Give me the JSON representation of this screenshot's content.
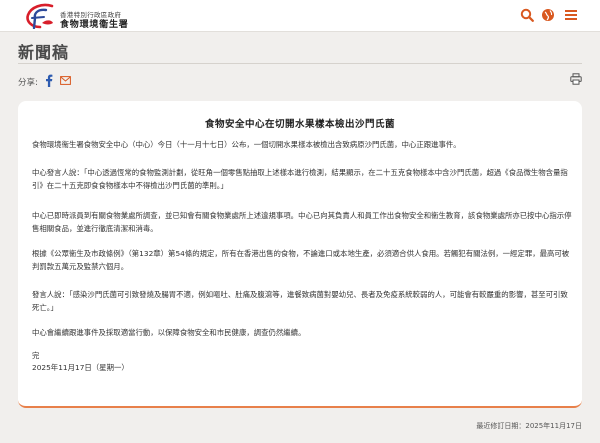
{
  "header": {
    "gov_name": "香港特別行政區政府",
    "dept_name": "食物環境衞生署",
    "logo_colors": {
      "red": "#d81e2a",
      "blue": "#2d4a9a"
    },
    "icons": [
      "search-icon",
      "globe-icon",
      "menu-icon"
    ],
    "icon_color": "#d9581f"
  },
  "page": {
    "title": "新聞稿"
  },
  "share": {
    "label": "分享:",
    "icons": [
      "facebook-icon",
      "email-icon",
      "print-icon"
    ]
  },
  "article": {
    "title": "食物安全中心在切開水果樣本檢出沙門氏菌",
    "paragraphs": [
      "食物環境衞生署食物安全中心（中心）今日（十一月十七日）公布，一個切開水果樣本被檢出含致病原沙門氏菌，中心正跟進事件。",
      "中心發言人說：「中心透過恆常的食物監測計劃，從旺角一個零售點抽取上述樣本進行檢測，結果顯示，在二十五克食物樣本中含沙門氏菌，超過《食品微生物含量指引》在二十五克即食食物樣本中不得檢出沙門氏菌的準則。」",
      "中心已即時派員到有關食物業處所調查，並已知會有關食物業處所上述違規事項。中心已向其負責人和員工作出食物安全和衞生教育，該食物業處所亦已按中心指示停售相關食品，並進行徹底清潔和消毒。",
      "根據《公眾衞生及市政條例》（第132章）第54條的規定，所有在香港出售的食物，不論進口或本地生產，必須適合供人食用。若觸犯有關法例，一經定罪，最高可被判罰款五萬元及監禁六個月。",
      "發言人說：「感染沙門氏菌可引致發燒及腸胃不適，例如嘔吐、肚痛及腹瀉等，進餐致病菌對嬰幼兒、長者及免疫系統較弱的人，可能會有較嚴重的影響，甚至可引致死亡。」",
      "中心會繼續跟進事件及採取適當行動，以保障食物安全和市民健康，調查仍然繼續。",
      "完",
      "2025年11月17日（星期一）"
    ]
  },
  "footer": {
    "last_revised": "最近修訂日期：2025年11月17日"
  },
  "colors": {
    "accent": "#e8804a",
    "background": "#f1efed"
  }
}
